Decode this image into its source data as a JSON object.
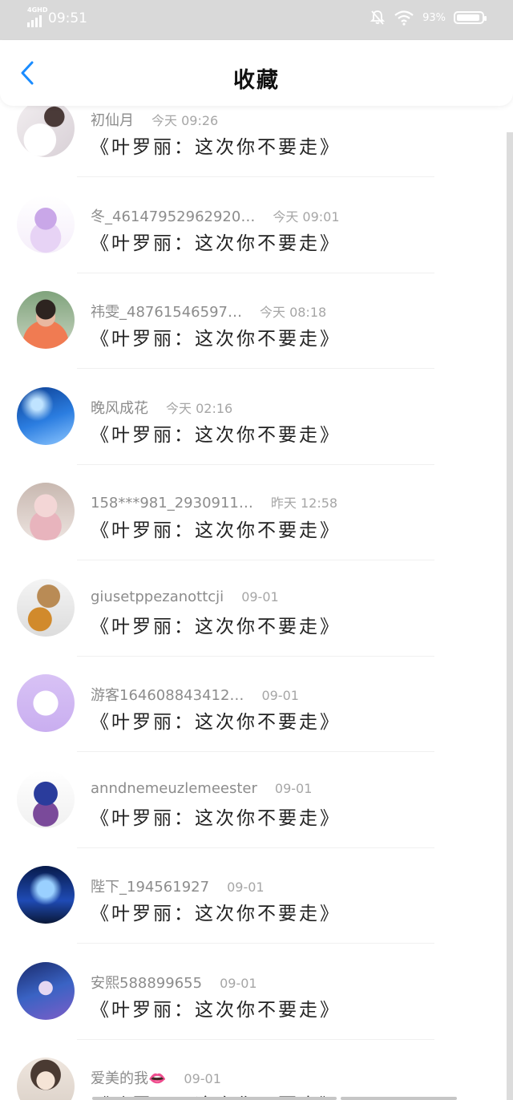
{
  "status_bar": {
    "network": "4GHD",
    "time": "09:51",
    "battery": "93%",
    "battery_level": 0.93,
    "icons": [
      "signal-icon",
      "mute-icon",
      "wifi-icon",
      "battery-icon"
    ]
  },
  "header": {
    "title": "收藏",
    "back_icon": "chevron-left-icon",
    "accent_color": "#1a8cff"
  },
  "favorites": [
    {
      "username": "初仙月",
      "time": "今天 09:26",
      "text": "《叶罗丽：这次你不要走》"
    },
    {
      "username": "冬_46147952962920…",
      "time": "今天 09:01",
      "text": "《叶罗丽：这次你不要走》"
    },
    {
      "username": "祎雯_48761546597…",
      "time": "今天 08:18",
      "text": "《叶罗丽：这次你不要走》"
    },
    {
      "username": "晚风成花",
      "time": "今天 02:16",
      "text": "《叶罗丽：这次你不要走》"
    },
    {
      "username": "158***981_2930911…",
      "time": "昨天 12:58",
      "text": "《叶罗丽：这次你不要走》"
    },
    {
      "username": "giusetppezanottcji",
      "time": "09-01",
      "text": "《叶罗丽：这次你不要走》"
    },
    {
      "username": "游客164608843412…",
      "time": "09-01",
      "text": "《叶罗丽：这次你不要走》"
    },
    {
      "username": "anndnemeuzlemeester",
      "time": "09-01",
      "text": "《叶罗丽：这次你不要走》"
    },
    {
      "username": "陛下_194561927",
      "time": "09-01",
      "text": "《叶罗丽：这次你不要走》"
    },
    {
      "username": "安熙588899655",
      "time": "09-01",
      "text": "《叶罗丽：这次你不要走》"
    },
    {
      "username": "爱美的我👄",
      "time": "09-01",
      "text": "《叶罗丽：这次你不要走》"
    }
  ]
}
